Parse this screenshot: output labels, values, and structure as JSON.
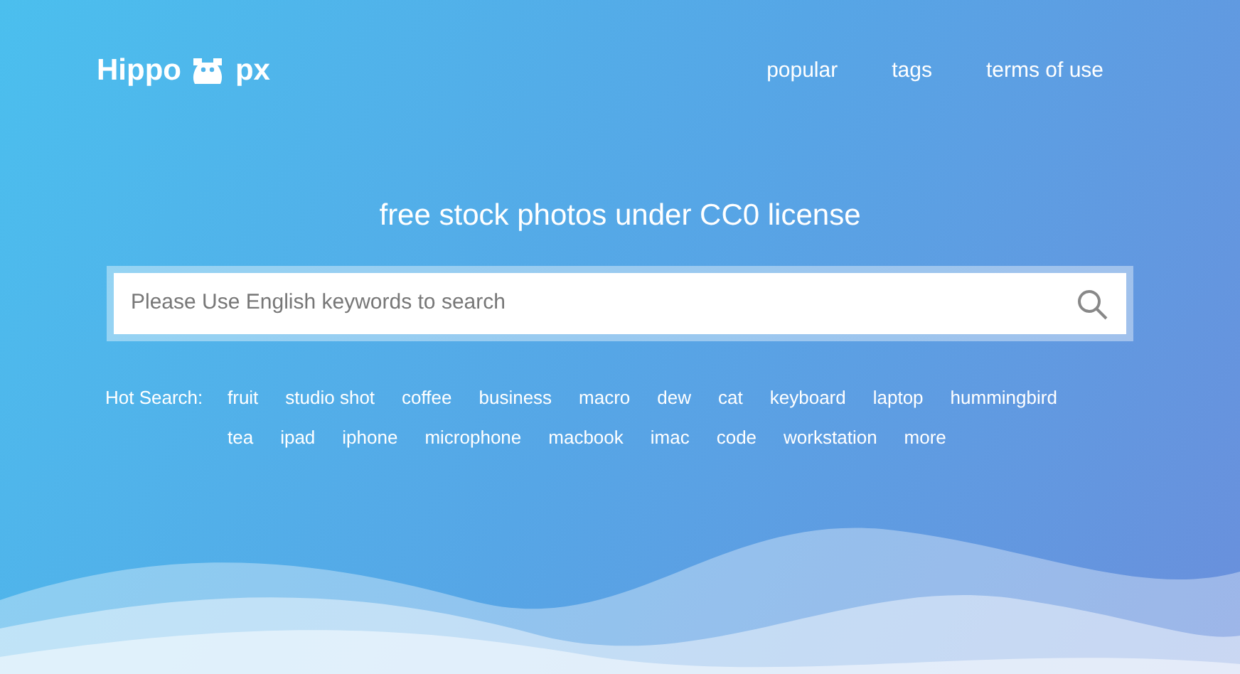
{
  "logo": {
    "left": "Hippo",
    "right": "px"
  },
  "nav": [
    "popular",
    "tags",
    "terms of use"
  ],
  "headline": "free stock photos under CC0 license",
  "search": {
    "placeholder": "Please Use English keywords to search"
  },
  "hot_search": {
    "label": "Hot Search:",
    "tags": [
      "fruit",
      "studio shot",
      "coffee",
      "business",
      "macro",
      "dew",
      "cat",
      "keyboard",
      "laptop",
      "hummingbird",
      "tea",
      "ipad",
      "iphone",
      "microphone",
      "macbook",
      "imac",
      "code",
      "workstation",
      "more"
    ]
  }
}
